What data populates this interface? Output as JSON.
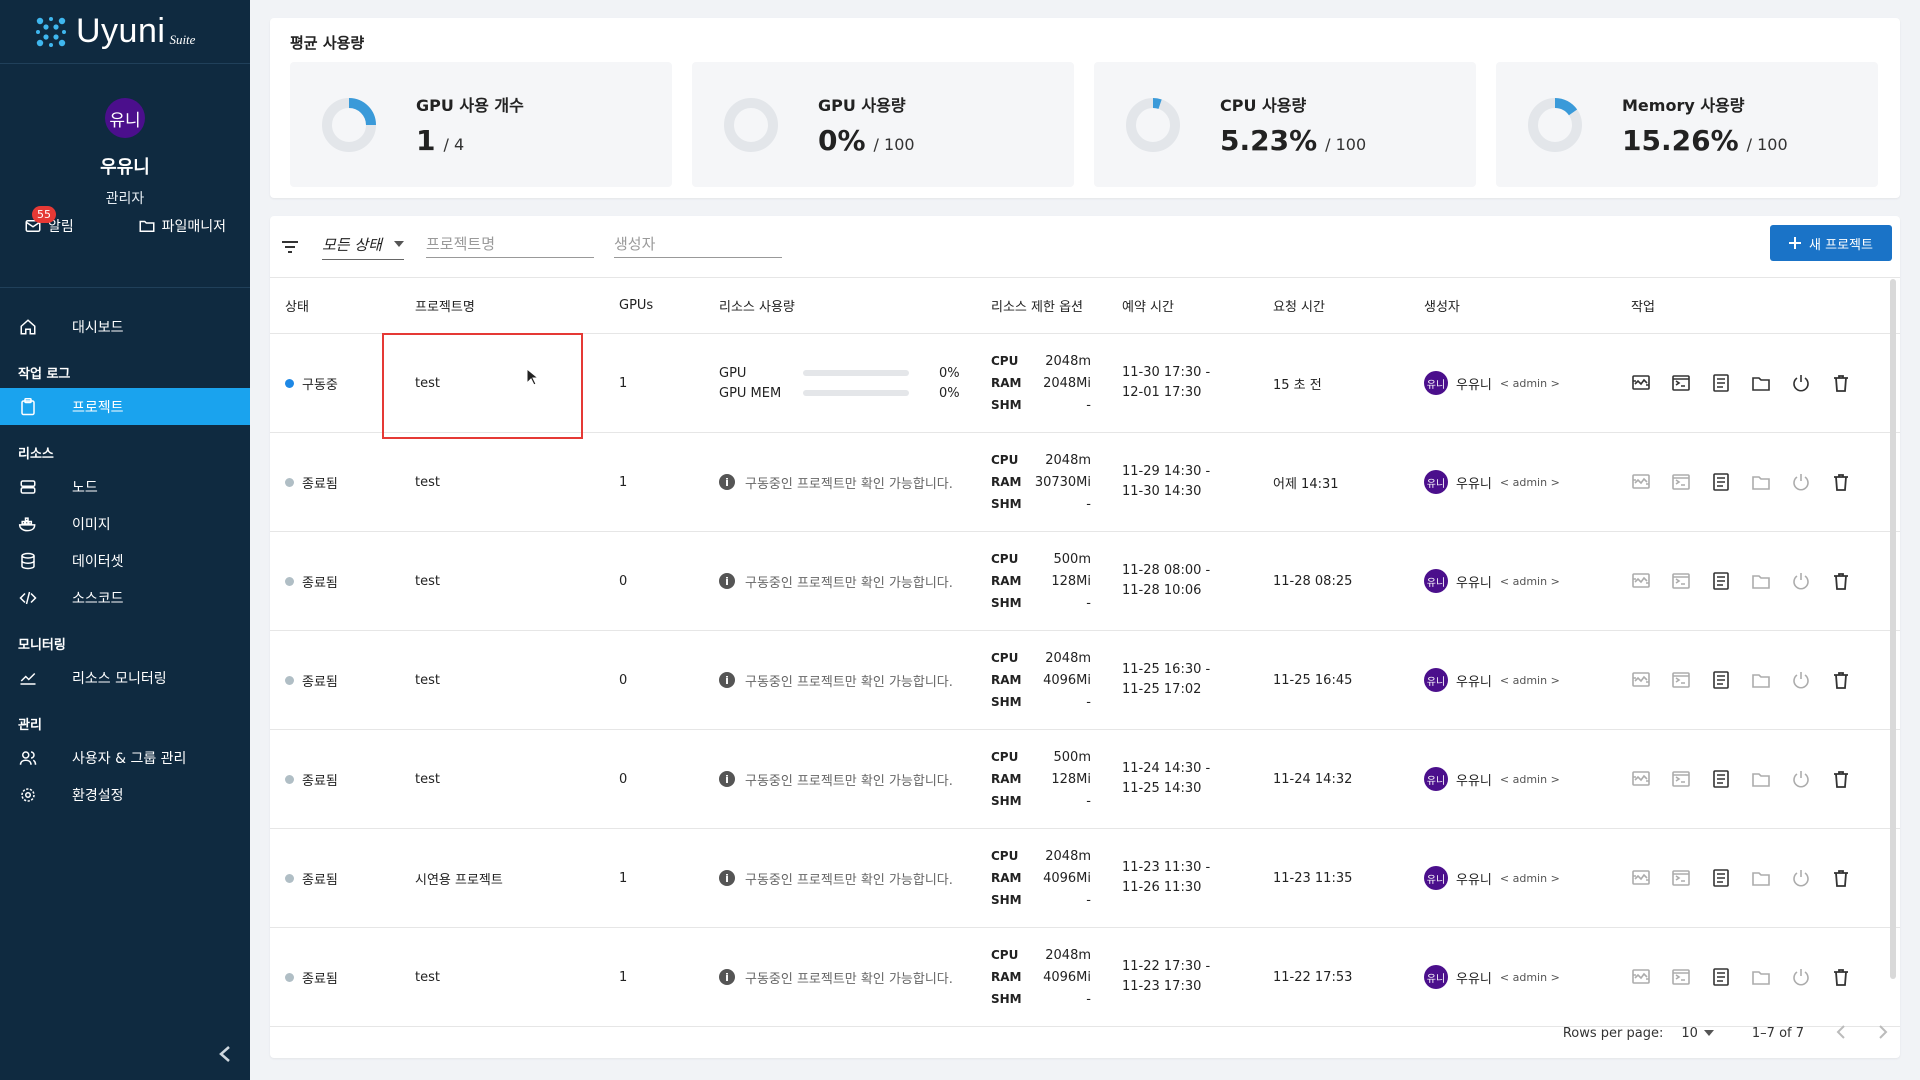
{
  "app": {
    "logo_text": "Uyuni",
    "logo_suite": "Suite"
  },
  "profile": {
    "avatar": "유니",
    "name": "우유니",
    "role": "관리자",
    "notifications_count": "55",
    "notifications_label": "알림",
    "file_manager_label": "파일매니저"
  },
  "nav": {
    "dashboard": "대시보드",
    "group_worklog": "작업 로그",
    "project": "프로젝트",
    "group_resource": "리소스",
    "node": "노드",
    "image": "이미지",
    "dataset": "데이터셋",
    "sourcecode": "소스코드",
    "group_monitoring": "모니터링",
    "resource_monitoring": "리소스 모니터링",
    "group_admin": "관리",
    "user_group": "사용자 & 그룹 관리",
    "settings": "환경설정"
  },
  "summary": {
    "title": "평균 사용량",
    "cards": [
      {
        "title": "GPU 사용 개수",
        "value": "1",
        "total": "/ 4",
        "fraction": 0.25
      },
      {
        "title": "GPU 사용량",
        "value": "0%",
        "total": "/ 100",
        "fraction": 0.0
      },
      {
        "title": "CPU 사용량",
        "value": "5.23%",
        "total": "/ 100",
        "fraction": 0.0523
      },
      {
        "title": "Memory 사용량",
        "value": "15.26%",
        "total": "/ 100",
        "fraction": 0.1526
      }
    ]
  },
  "toolbar": {
    "status_select": "모든 상태",
    "name_placeholder": "프로젝트명",
    "owner_placeholder": "생성자",
    "new_button": "새 프로젝트"
  },
  "table": {
    "headers": {
      "status": "상태",
      "name": "프로젝트명",
      "gpus": "GPUs",
      "usage": "리소스 사용량",
      "limits": "리소스 제한 옵션",
      "reserved": "예약 시간",
      "requested": "요청 시간",
      "owner": "생성자",
      "actions": "작업"
    },
    "running_notice": "구동중인 프로젝트만 확인 가능합니다.",
    "limit_keys": {
      "cpu": "CPU",
      "ram": "RAM",
      "shm": "SHM"
    },
    "usage_labels": {
      "gpu": "GPU",
      "gpu_mem": "GPU MEM"
    },
    "rows": [
      {
        "status": "구동중",
        "status_color": "#1e88e5",
        "name": "test",
        "gpus": "1",
        "gpu_pct": "0%",
        "gpu_mem_pct": "0%",
        "cpu": "2048m",
        "ram": "2048Mi",
        "shm": "-",
        "reserved_start": "11-30 17:30 -",
        "reserved_end": "12-01 17:30",
        "requested": "15 초 전",
        "owner": "우유니",
        "owner_avatar": "유니",
        "owner_role": "< admin >",
        "active": true
      },
      {
        "status": "종료됨",
        "status_color": "#b0bec5",
        "name": "test",
        "gpus": "1",
        "cpu": "2048m",
        "ram": "30730Mi",
        "shm": "-",
        "reserved_start": "11-29 14:30 -",
        "reserved_end": "11-30 14:30",
        "requested": "어제 14:31",
        "owner": "우유니",
        "owner_avatar": "유니",
        "owner_role": "< admin >",
        "active": false
      },
      {
        "status": "종료됨",
        "status_color": "#b0bec5",
        "name": "test",
        "gpus": "0",
        "cpu": "500m",
        "ram": "128Mi",
        "shm": "-",
        "reserved_start": "11-28 08:00 -",
        "reserved_end": "11-28 10:06",
        "requested": "11-28 08:25",
        "owner": "우유니",
        "owner_avatar": "유니",
        "owner_role": "< admin >",
        "active": false
      },
      {
        "status": "종료됨",
        "status_color": "#b0bec5",
        "name": "test",
        "gpus": "0",
        "cpu": "2048m",
        "ram": "4096Mi",
        "shm": "-",
        "reserved_start": "11-25 16:30 -",
        "reserved_end": "11-25 17:02",
        "requested": "11-25 16:45",
        "owner": "우유니",
        "owner_avatar": "유니",
        "owner_role": "< admin >",
        "active": false
      },
      {
        "status": "종료됨",
        "status_color": "#b0bec5",
        "name": "test",
        "gpus": "0",
        "cpu": "500m",
        "ram": "128Mi",
        "shm": "-",
        "reserved_start": "11-24 14:30 -",
        "reserved_end": "11-25 14:30",
        "requested": "11-24 14:32",
        "owner": "우유니",
        "owner_avatar": "유니",
        "owner_role": "< admin >",
        "active": false
      },
      {
        "status": "종료됨",
        "status_color": "#b0bec5",
        "name": "시연용 프로젝트",
        "gpus": "1",
        "cpu": "2048m",
        "ram": "4096Mi",
        "shm": "-",
        "reserved_start": "11-23 11:30 -",
        "reserved_end": "11-26 11:30",
        "requested": "11-23 11:35",
        "owner": "우유니",
        "owner_avatar": "유니",
        "owner_role": "< admin >",
        "active": false
      },
      {
        "status": "종료됨",
        "status_color": "#b0bec5",
        "name": "test",
        "gpus": "1",
        "cpu": "2048m",
        "ram": "4096Mi",
        "shm": "-",
        "reserved_start": "11-22 17:30 -",
        "reserved_end": "11-23 17:30",
        "requested": "11-22 17:53",
        "owner": "우유니",
        "owner_avatar": "유니",
        "owner_role": "< admin >",
        "active": false
      }
    ]
  },
  "pagination": {
    "rows_label": "Rows per page:",
    "rows_value": "10",
    "range": "1–7 of 7"
  },
  "colors": {
    "sidebar": "#0f2a40",
    "accent": "#1aa3ee",
    "primary_button": "#1a73c7",
    "avatar": "#4b0f8c",
    "highlight": "#e53935"
  }
}
